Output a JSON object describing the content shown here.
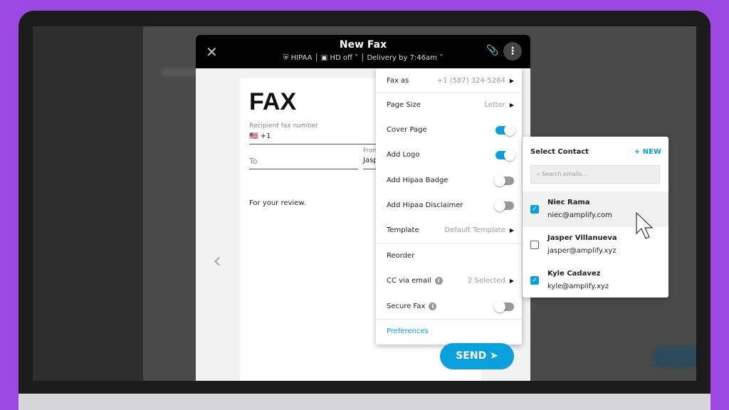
{
  "header": {
    "title": "New Fax",
    "hipaa": "HIPAA",
    "hd": "HD off",
    "delivery": "Delivery by 7:46am"
  },
  "document": {
    "heading": "FAX",
    "recipient_label": "Recipient fax number",
    "country_code": "+1",
    "to_placeholder": "To",
    "from_label": "From",
    "from_value": "Jasp",
    "body": "For your review."
  },
  "menu": {
    "fax_as": {
      "label": "Fax as",
      "value": "+1 (587) 324-5264"
    },
    "page_size": {
      "label": "Page Size",
      "value": "Letter"
    },
    "cover_page": {
      "label": "Cover Page",
      "on": true
    },
    "add_logo": {
      "label": "Add Logo",
      "on": true
    },
    "hipaa_badge": {
      "label": "Add Hipaa Badge",
      "on": false
    },
    "hipaa_disclaimer": {
      "label": "Add Hipaa Disclaimer",
      "on": false
    },
    "template": {
      "label": "Template",
      "value": "Default Template"
    },
    "reorder": {
      "label": "Reorder"
    },
    "cc": {
      "label": "CC via email",
      "value": "2 Selected"
    },
    "secure_fax": {
      "label": "Secure Fax",
      "on": false
    },
    "preferences": "Preferences"
  },
  "send_label": "SEND",
  "contacts": {
    "title": "Select Contact",
    "new_label": "+ NEW",
    "search_placeholder": "Search emails...",
    "items": [
      {
        "name": "Niec Rama",
        "email": "niec@amplify.com",
        "checked": true
      },
      {
        "name": "Jasper Villanueva",
        "email": "jasper@amplify.xyz",
        "checked": false
      },
      {
        "name": "Kyle Cadavez",
        "email": "kyle@amplify.xyz",
        "checked": true
      }
    ]
  },
  "colors": {
    "accent": "#0aa0dc",
    "frame": "#9a48e0"
  }
}
